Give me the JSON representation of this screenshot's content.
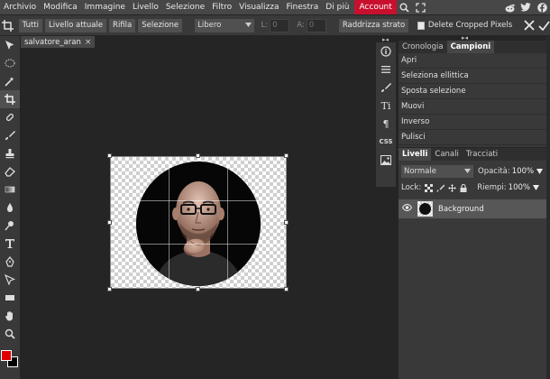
{
  "menu": {
    "items": [
      "Archivio",
      "Modifica",
      "Immagine",
      "Livello",
      "Selezione",
      "Filtro",
      "Visualizza",
      "Finestra",
      "Di più"
    ],
    "account_label": "Account"
  },
  "options": {
    "buttons": [
      "Tutti",
      "Livello attuale",
      "Rifila",
      "Selezione"
    ],
    "ratio_select": "Libero",
    "field_l_label": "L:",
    "field_l_value": "0",
    "field_a_label": "A:",
    "field_a_value": "0",
    "straighten_label": "Raddrizza strato",
    "delete_cropped_label": "Delete Cropped Pixels"
  },
  "document": {
    "tab_title": "salvatore_aran",
    "close_glyph": "×"
  },
  "iconcol": {
    "css_label": "CSS",
    "type_glyph": "Ti",
    "para_glyph": "¶"
  },
  "history_panel": {
    "tabs": [
      "Cronologia",
      "Campioni"
    ],
    "items": [
      "Apri",
      "Seleziona ellittica",
      "Sposta selezione",
      "Muovi",
      "Inverso",
      "Pulisci"
    ]
  },
  "layers_panel": {
    "tabs": [
      "Livelli",
      "Canali",
      "Tracciati"
    ],
    "blend_mode": "Normale",
    "opacity_label": "Opacità:",
    "opacity_value": "100%",
    "lock_label": "Lock:",
    "fill_label": "Riempi:",
    "fill_value": "100%",
    "layers": [
      {
        "name": "Background"
      }
    ]
  },
  "colors": {
    "foreground": "#e00000",
    "background": "#000000",
    "account_bg": "#c8102e"
  }
}
